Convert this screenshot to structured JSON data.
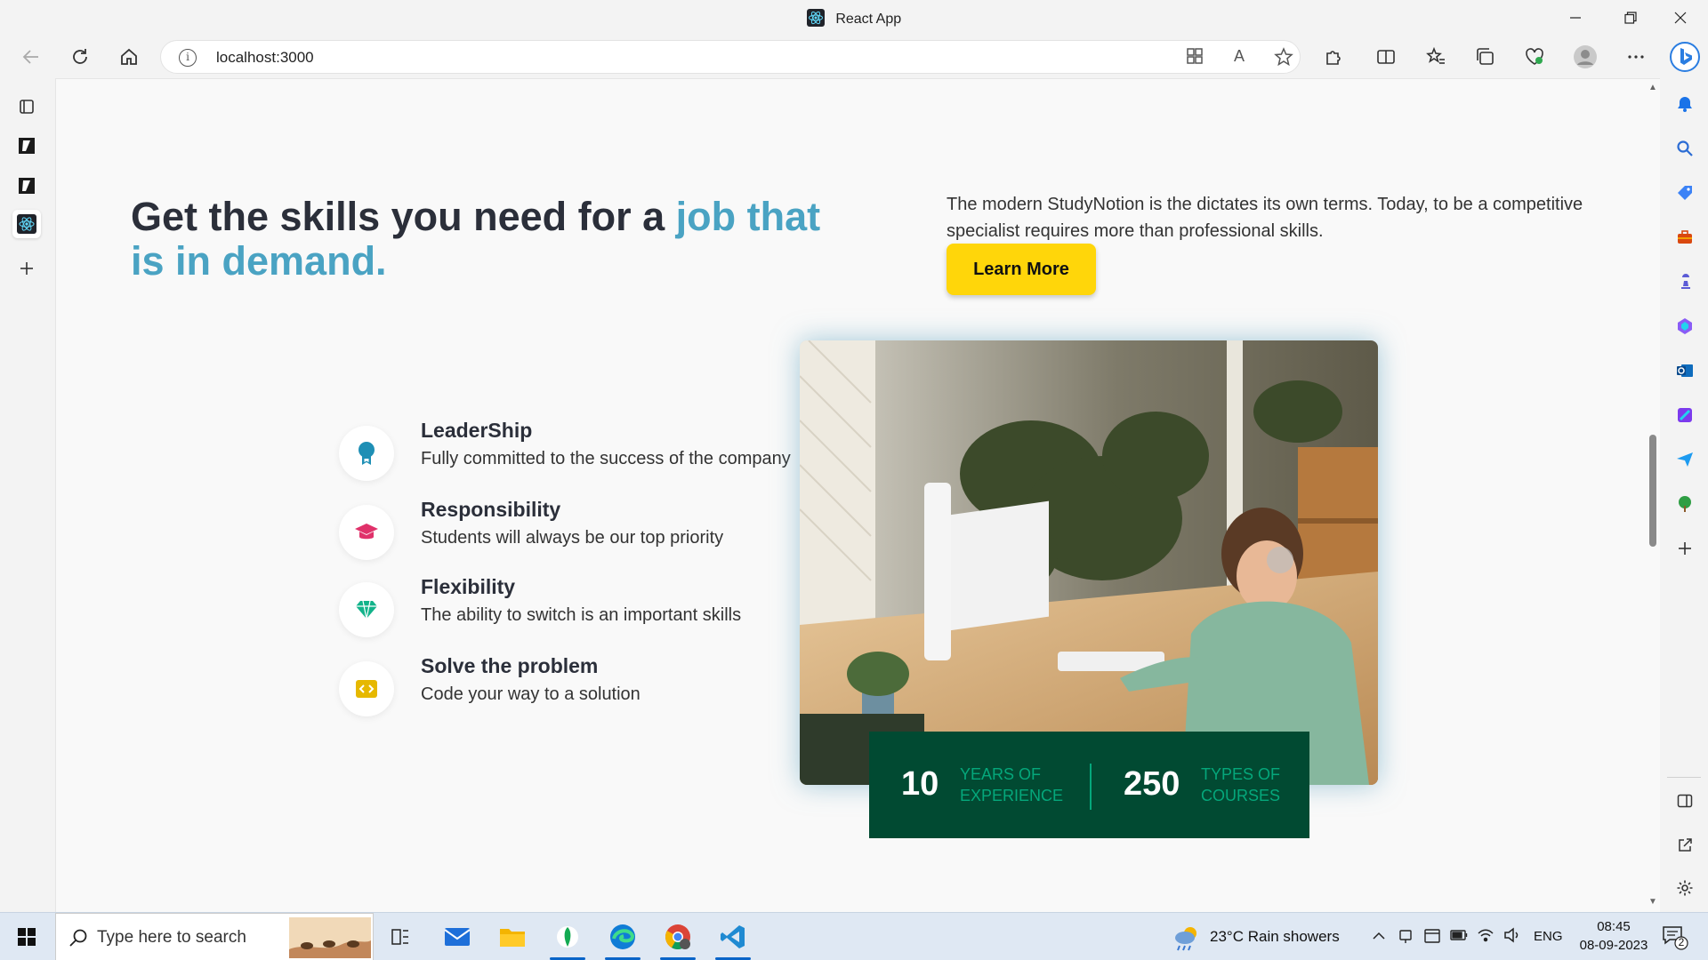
{
  "window": {
    "title": "React App",
    "minimize": "—",
    "restore": "❐",
    "close": "✕"
  },
  "toolbar": {
    "url": "localhost:3000",
    "read_aloud": "A"
  },
  "page": {
    "headline_prefix": "Get the skills you need for a ",
    "headline_accent": "job that is in demand.",
    "intro": "The modern StudyNotion is the dictates its own terms. Today, to be a competitive specialist requires more than professional skills.",
    "cta_label": "Learn More",
    "features": [
      {
        "title": "LeaderShip",
        "desc": "Fully committed to the success of the company",
        "icon": "ribbon-icon",
        "color": "#1e8fb5"
      },
      {
        "title": "Responsibility",
        "desc": "Students will always be our top priority",
        "icon": "graduation-cap-icon",
        "color": "#e0316a"
      },
      {
        "title": "Flexibility",
        "desc": "The ability to switch is an important skills",
        "icon": "diamond-icon",
        "color": "#12b38a"
      },
      {
        "title": "Solve the problem",
        "desc": "Code your way to a solution",
        "icon": "code-icon",
        "color": "#e6b800"
      }
    ],
    "stats": [
      {
        "number": "10",
        "label_line1": "YEARS OF",
        "label_line2": "EXPERIENCE"
      },
      {
        "number": "250",
        "label_line1": "TYPES OF",
        "label_line2": "COURSES"
      }
    ]
  },
  "taskbar": {
    "search_placeholder": "Type here to search",
    "weather": "23°C  Rain showers",
    "language": "ENG",
    "time": "08:45",
    "date": "08-09-2023",
    "notifications": "2"
  },
  "colors": {
    "accent": "#4aa3c3",
    "cta": "#ffd60a",
    "stats_bg": "#014a32",
    "stats_label": "#05a77b"
  }
}
